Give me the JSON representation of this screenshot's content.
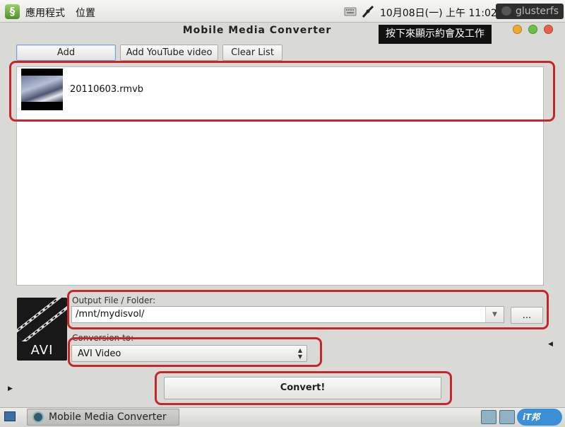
{
  "topbar": {
    "menu_apps": "應用程式",
    "menu_places": "位置",
    "clock": "10月08日(一) 上午 11:02",
    "user": "glusterfs"
  },
  "window": {
    "title": "Mobile Media Converter",
    "tooltip": "按下來顯示約會及工作"
  },
  "toolbar": {
    "add_label": "Add",
    "add_youtube_label": "Add YouTube video",
    "clear_list_label": "Clear List"
  },
  "files": [
    {
      "name": "20110603.rmvb"
    }
  ],
  "output": {
    "label": "Output File / Folder:",
    "path": "/mnt/mydisvol/",
    "browse_label": "..."
  },
  "conversion": {
    "label": "Conversion to:",
    "selected": "AVI Video",
    "format_badge": "AVI"
  },
  "convert_label": "Convert!",
  "taskbar": {
    "task_label": "Mobile Media Converter",
    "badge_label": "iT邦"
  },
  "colors": {
    "highlight": "#c4262b",
    "window_bg": "#d9d9d6",
    "close": "#e8624a",
    "minimize": "#f0a830",
    "maximize": "#6cc04a"
  },
  "icons": [
    "app-menu-icon",
    "keyboard-icon",
    "network-icon",
    "chat-bubble-icon",
    "film-strip-icon",
    "dropdown-arrow-icon",
    "spin-arrows-icon",
    "show-desktop-icon",
    "converter-app-icon"
  ]
}
